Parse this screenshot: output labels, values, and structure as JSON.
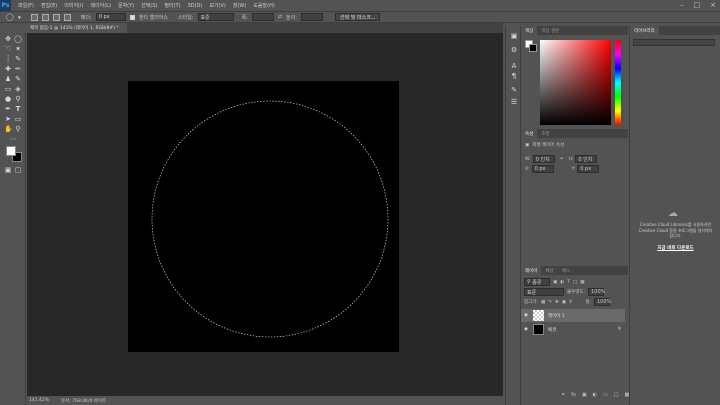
{
  "app": {
    "logo": "Ps"
  },
  "menu": [
    "파일(F)",
    "편집(E)",
    "이미지(I)",
    "레이어(L)",
    "문자(Y)",
    "선택(S)",
    "필터(T)",
    "3D(D)",
    "보기(V)",
    "창(W)",
    "도움말(H)"
  ],
  "options": {
    "feather_label": "페더:",
    "feather_value": "0 px",
    "antialias_label": "앤티 앨리어스",
    "style_label": "스타일:",
    "style_value": "표준",
    "width_label": "폭:",
    "height_label": "높이:",
    "select_mask_button": "선택 및 마스크..."
  },
  "document": {
    "tab_title": "제목 없음-1 @ 141% (레이어 1, RGB/8#) *"
  },
  "status": {
    "zoom": "141.42%",
    "doc_info": "문서: 768.0K/0 바이트"
  },
  "panels": {
    "color_tabs": [
      "색상",
      "색상 견본"
    ],
    "properties_tabs": [
      "속성",
      "조정"
    ],
    "properties_title": "픽셀 레이어 속성",
    "prop_w_label": "W:",
    "prop_w_value": "0 인치",
    "prop_h_label": "H:",
    "prop_h_value": "0 인치",
    "prop_x_label": "X:",
    "prop_x_value": "0 px",
    "prop_y_label": "Y:",
    "prop_y_value": "0 px",
    "layers_tabs": [
      "레이어",
      "채널",
      "패스"
    ],
    "kind_label": "종류",
    "blend_mode": "표준",
    "opacity_label": "불투명도:",
    "opacity_value": "100%",
    "lock_label": "잠그기:",
    "fill_label": "칠:",
    "fill_value": "100%",
    "layers": [
      {
        "name": "레이어 1",
        "selected": true
      },
      {
        "name": "배경",
        "selected": false
      }
    ]
  },
  "libraries": {
    "tab": "라이브러리",
    "message_line1": "Creative Cloud Libraries를 사용하려면",
    "message_line2": "Creative Cloud 응용 프로그램을 설치해야",
    "message_line3": "합니다.",
    "install_link": "지금 바로 다운로드"
  },
  "colors": {
    "foreground": "#ffffff",
    "background": "#000000",
    "hue_selected": "#ff0000"
  }
}
